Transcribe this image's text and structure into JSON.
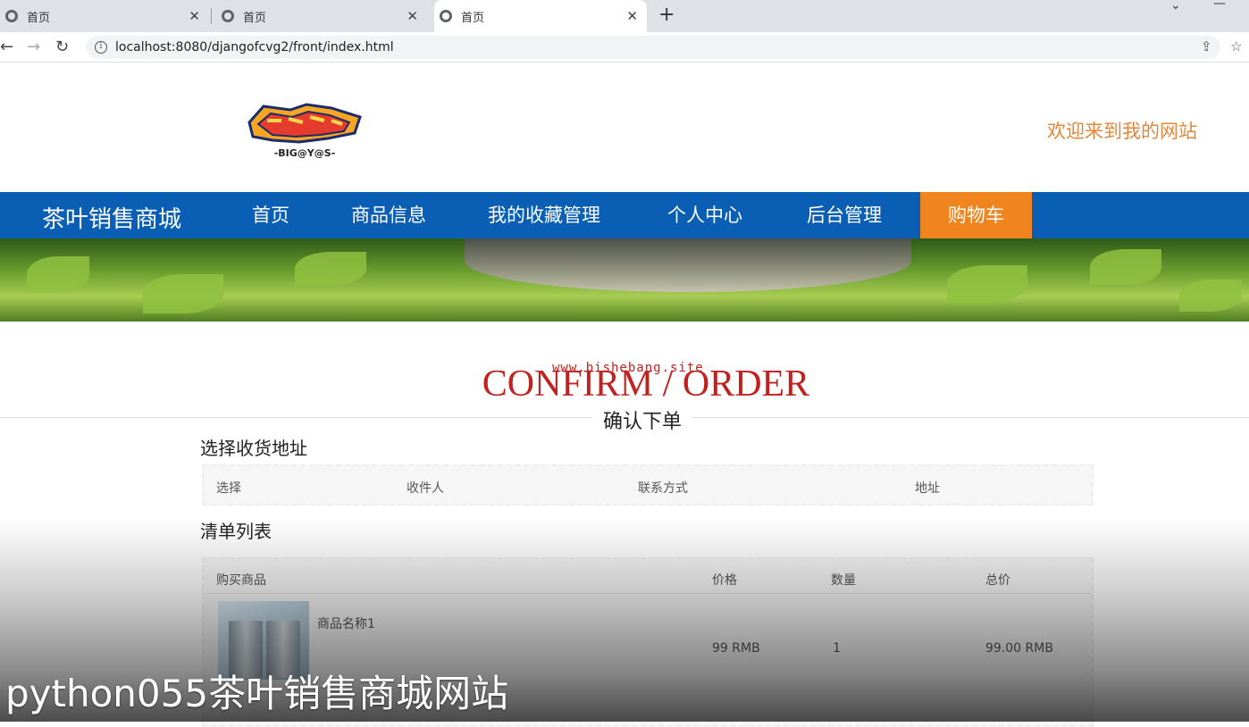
{
  "browser": {
    "tabs": [
      {
        "title": "首页"
      },
      {
        "title": "首页"
      },
      {
        "title": "首页",
        "active": true
      }
    ],
    "url": "localhost:8080/djangofcvg2/front/index.html"
  },
  "header": {
    "logo_text": "-BIG@Y@S-",
    "welcome": "欢迎来到我的网站"
  },
  "nav": {
    "brand": "茶叶销售商城",
    "items": [
      "首页",
      "商品信息",
      "我的收藏管理",
      "个人中心",
      "后台管理",
      "购物车"
    ],
    "active_index": 5
  },
  "page": {
    "watermark": "www.bishebang.site",
    "title_en": "CONFIRM / ORDER",
    "title_cn": "确认下单"
  },
  "address": {
    "heading": "选择收货地址",
    "columns": [
      "选择",
      "收件人",
      "联系方式",
      "地址"
    ]
  },
  "order": {
    "heading": "清单列表",
    "columns": [
      "购买商品",
      "价格",
      "数量",
      "总价"
    ],
    "rows": [
      {
        "name": "商品名称1",
        "price": "99 RMB",
        "qty": "1",
        "total": "99.00 RMB"
      }
    ]
  },
  "caption": "python055茶叶销售商城网站",
  "colors": {
    "nav_bg": "#0a5fb4",
    "nav_active": "#f0841f",
    "welcome": "#e0873a",
    "title_red": "#c0221f"
  }
}
